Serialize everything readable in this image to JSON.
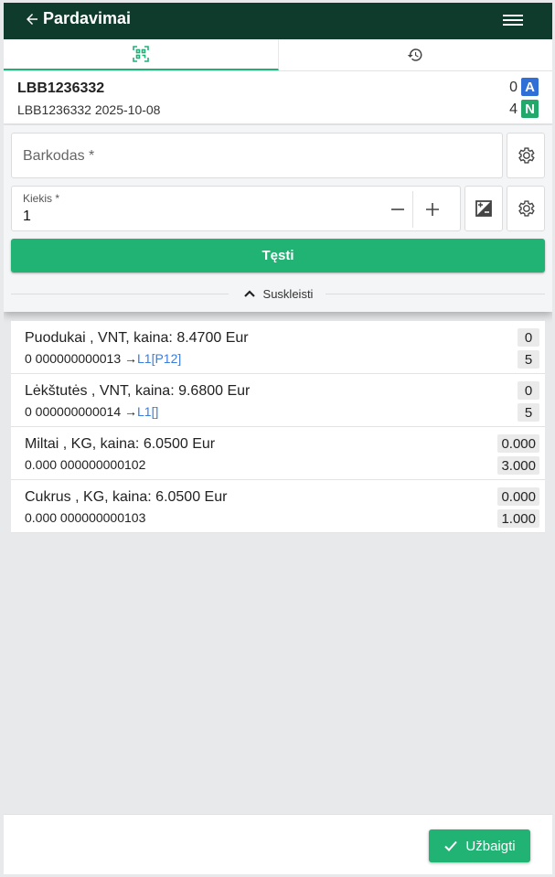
{
  "header": {
    "title": "Pardavimai"
  },
  "tabs": [
    {
      "icon": "qr-scan-icon",
      "active": true
    },
    {
      "icon": "history-icon",
      "active": false
    }
  ],
  "document": {
    "id": "LBB1236332",
    "subtitle": "LBB1236332 2025-10-08",
    "count_a": "0",
    "badge_a": "A",
    "count_n": "4",
    "badge_n": "N",
    "badge_a_color": "#2f6fd6",
    "badge_n_color": "#21a86a"
  },
  "form": {
    "barcode_placeholder": "Barkodas *",
    "quantity_label": "Kiekis *",
    "quantity_value": "1",
    "continue_label": "Tęsti",
    "collapse_label": "Suskleisti"
  },
  "items": [
    {
      "title": "Puodukai , VNT, kaina: 8.4700 Eur",
      "sub": "0 000000000013 →",
      "loc": "L1[P12]",
      "top": "0",
      "bottom": "5"
    },
    {
      "title": "Lėkštutės , VNT, kaina: 9.6800 Eur",
      "sub": "0 000000000014 →",
      "loc": "L1[]",
      "top": "0",
      "bottom": "5"
    },
    {
      "title": "Miltai , KG, kaina: 6.0500 Eur",
      "sub": "0.000 000000000102",
      "loc": "",
      "top": "0.000",
      "bottom": "3.000"
    },
    {
      "title": "Cukrus , KG, kaina: 6.0500 Eur",
      "sub": "0.000 000000000103",
      "loc": "",
      "top": "0.000",
      "bottom": "1.000"
    }
  ],
  "footer": {
    "finish_label": "Užbaigti"
  },
  "colors": {
    "header_bg": "#0e3b2b",
    "accent": "#21b374"
  }
}
